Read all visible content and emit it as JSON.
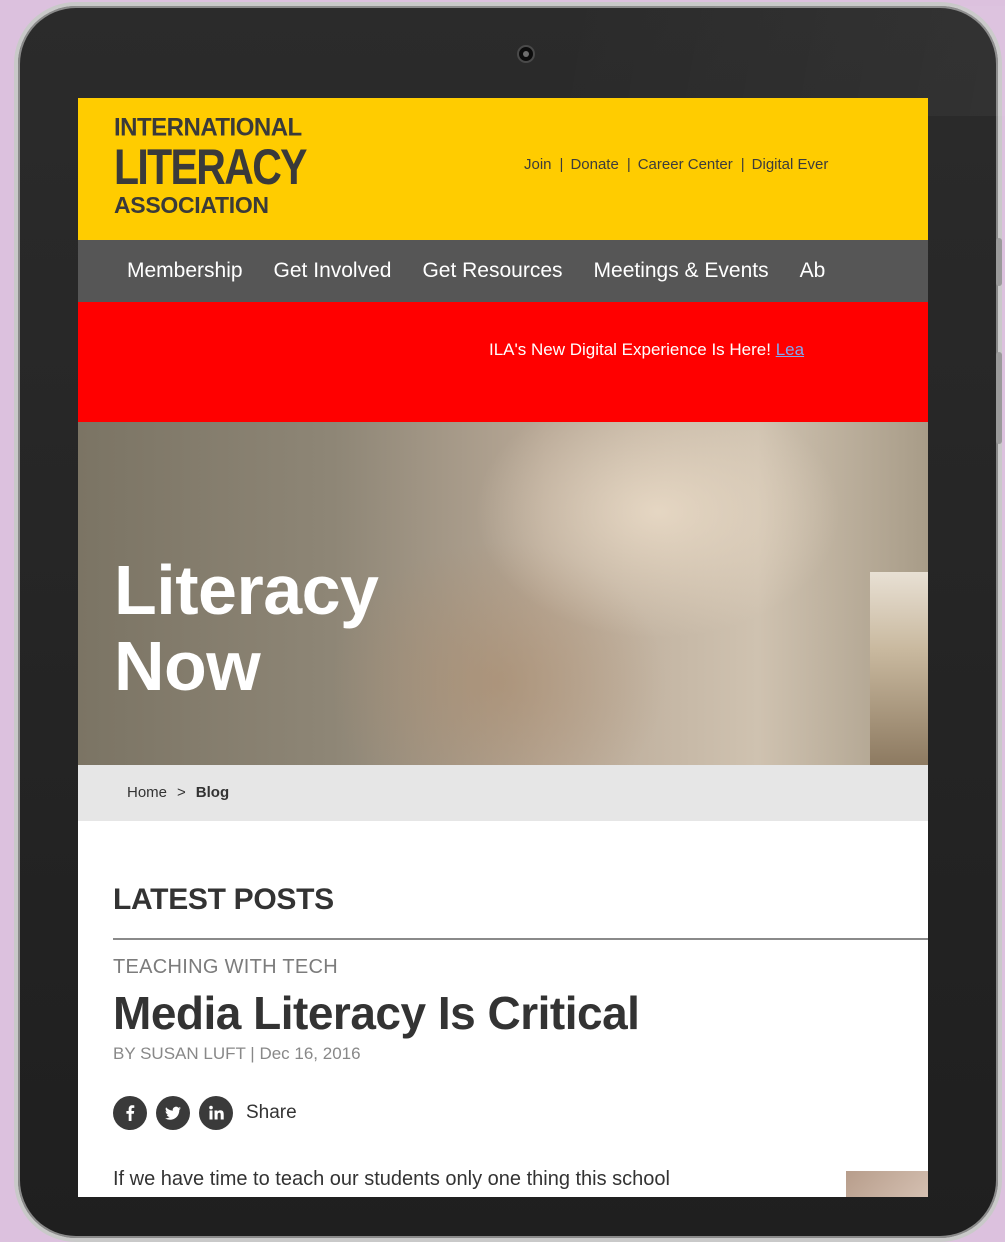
{
  "logo": {
    "line1": "INTERNATIONAL",
    "line2": "LITERACY",
    "line3": "ASSOCIATION"
  },
  "utility_links": [
    "Join",
    "Donate",
    "Career Center",
    "Digital Ever"
  ],
  "nav": [
    "Membership",
    "Get Involved",
    "Get Resources",
    "Meetings & Events",
    "Ab"
  ],
  "alert": {
    "text": "ILA's New Digital Experience Is Here! ",
    "link": "Lea"
  },
  "hero": {
    "title_line1": "Literacy",
    "title_line2": "Now"
  },
  "breadcrumb": {
    "home": "Home",
    "separator": ">",
    "current": "Blog"
  },
  "content": {
    "section_heading": "LATEST POSTS",
    "category": "TEACHING WITH TECH",
    "post_title": "Media Literacy Is Critical",
    "byline": "BY SUSAN LUFT | Dec 16, 2016",
    "share_label": "Share",
    "excerpt": "If we have time to teach our students only one thing this school"
  },
  "social_icons": [
    "facebook-icon",
    "twitter-icon",
    "linkedin-icon"
  ],
  "colors": {
    "header_yellow": "#ffcc00",
    "nav_gray": "#565656",
    "alert_red": "#ff0000",
    "text_dark": "#333333"
  }
}
